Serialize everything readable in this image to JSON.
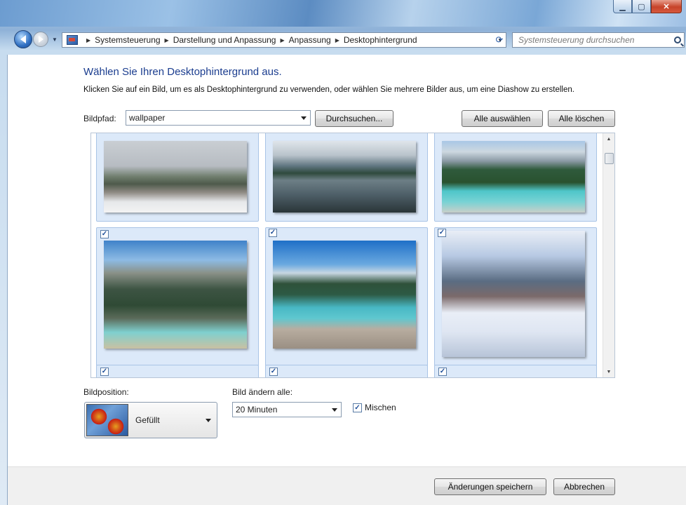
{
  "window": {
    "caption_buttons": [
      "minimize-icon",
      "maximize-icon",
      "close-icon"
    ]
  },
  "navigation": {
    "breadcrumbs": [
      "Systemsteuerung",
      "Darstellung und Anpassung",
      "Anpassung",
      "Desktophintergrund"
    ],
    "search_placeholder": "Systemsteuerung durchsuchen"
  },
  "main": {
    "title": "Wählen Sie Ihren Desktophintergrund aus.",
    "description": "Klicken Sie auf ein Bild, um es als Desktophintergrund zu verwenden, oder wählen Sie mehrere Bilder aus, um eine Diashow zu erstellen.",
    "path_label": "Bildpfad:",
    "path_value": "wallpaper",
    "browse_label": "Durchsuchen...",
    "select_all_label": "Alle auswählen",
    "clear_all_label": "Alle löschen"
  },
  "gallery": {
    "images": [
      {
        "name": "snowy-lodge-mountains",
        "checked": true
      },
      {
        "name": "mountain-lake-fjord",
        "checked": true
      },
      {
        "name": "turquoise-lake-forest",
        "checked": true
      },
      {
        "name": "mountain-valley-cliffs",
        "checked": true
      },
      {
        "name": "turquoise-lake-shore",
        "checked": true
      },
      {
        "name": "snowy-tree-garden",
        "checked": true
      }
    ],
    "next_row_checked": [
      true,
      true,
      true
    ]
  },
  "options": {
    "position_label": "Bildposition:",
    "position_value": "Gefüllt",
    "interval_label": "Bild ändern alle:",
    "interval_value": "20 Minuten",
    "shuffle_label": "Mischen",
    "shuffle_checked": true
  },
  "footer": {
    "save_label": "Änderungen speichern",
    "cancel_label": "Abbrechen"
  }
}
